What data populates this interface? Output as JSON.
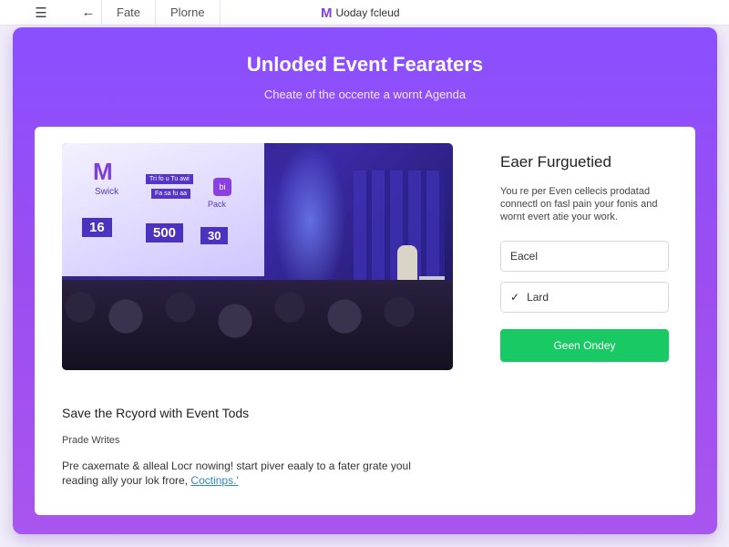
{
  "topbar": {
    "tab1": "Fate",
    "tab2": "Plorne",
    "brand_mark": "M",
    "brand_name": "Uoday fcleud"
  },
  "hero": {
    "title": "Unloded Event Fearaters",
    "subtitle": "Cheate of the occente a wornt Agenda"
  },
  "event_image": {
    "screen_logo": "M",
    "screen_caption": "Swick",
    "screen_chip1": "Tri fo u Tu awi",
    "screen_chip2": "Fa sa fu aa",
    "badge_text": "bi",
    "badge_caption": "Pack",
    "stat1": "16",
    "stat2": "500",
    "stat3": "30"
  },
  "section": {
    "title": "Save the Rcyord with Event Tods",
    "subtitle": "Prade Writes",
    "body": "Pre caxemate & alleal Locr nowing! start piver eaaly to a fater grate youl reading ally your lok frore,",
    "link": "Coctinps.'"
  },
  "panel": {
    "title": "Eaer Furguetied",
    "description": "You re per Even cellecis prodatad connectl on fasl pain your fonis and wornt evert atie your work.",
    "field1": "Eacel",
    "field2": "Lard",
    "cta": "Geen Ondey"
  },
  "colors": {
    "frame_gradient_start": "#8a4fff",
    "frame_gradient_end": "#a955ef",
    "cta": "#18c964",
    "link": "#2a8ac9"
  },
  "icons": {
    "menu": "hamburger-icon",
    "back": "arrow-left-icon",
    "check": "checkmark-icon"
  }
}
